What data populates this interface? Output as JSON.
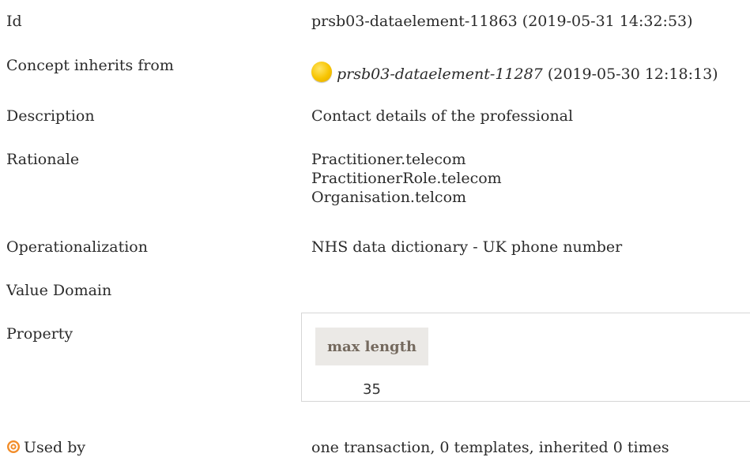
{
  "rows": {
    "id": {
      "label": "Id",
      "value": "prsb03-dataelement-11863 (2019-05-31 14:32:53)"
    },
    "inherits": {
      "label": "Concept inherits from",
      "ref_id": "prsb03-dataelement-11287",
      "ref_date": " (2019-05-30 12:18:13)",
      "icon": "yellow-circle-icon"
    },
    "description": {
      "label": "Description",
      "value": "Contact details of the professional"
    },
    "rationale": {
      "label": "Rationale",
      "lines": [
        "Practitioner.telecom",
        "PractitionerRole.telecom",
        "Organisation.telcom"
      ]
    },
    "operationalization": {
      "label": "Operationalization",
      "value": "NHS data dictionary - UK phone number"
    },
    "value_domain": {
      "label": "Value Domain"
    },
    "property": {
      "label": "Property",
      "header": "max length",
      "value": "35"
    },
    "used_by": {
      "label": "Used by",
      "value": "one transaction, 0 templates, inherited 0 times",
      "icon": "target-icon"
    }
  },
  "colors": {
    "header_bg": "#ebe9e6",
    "header_text": "#74695e",
    "icon_yellow": "#f7c400",
    "icon_target": "#f28c28"
  }
}
